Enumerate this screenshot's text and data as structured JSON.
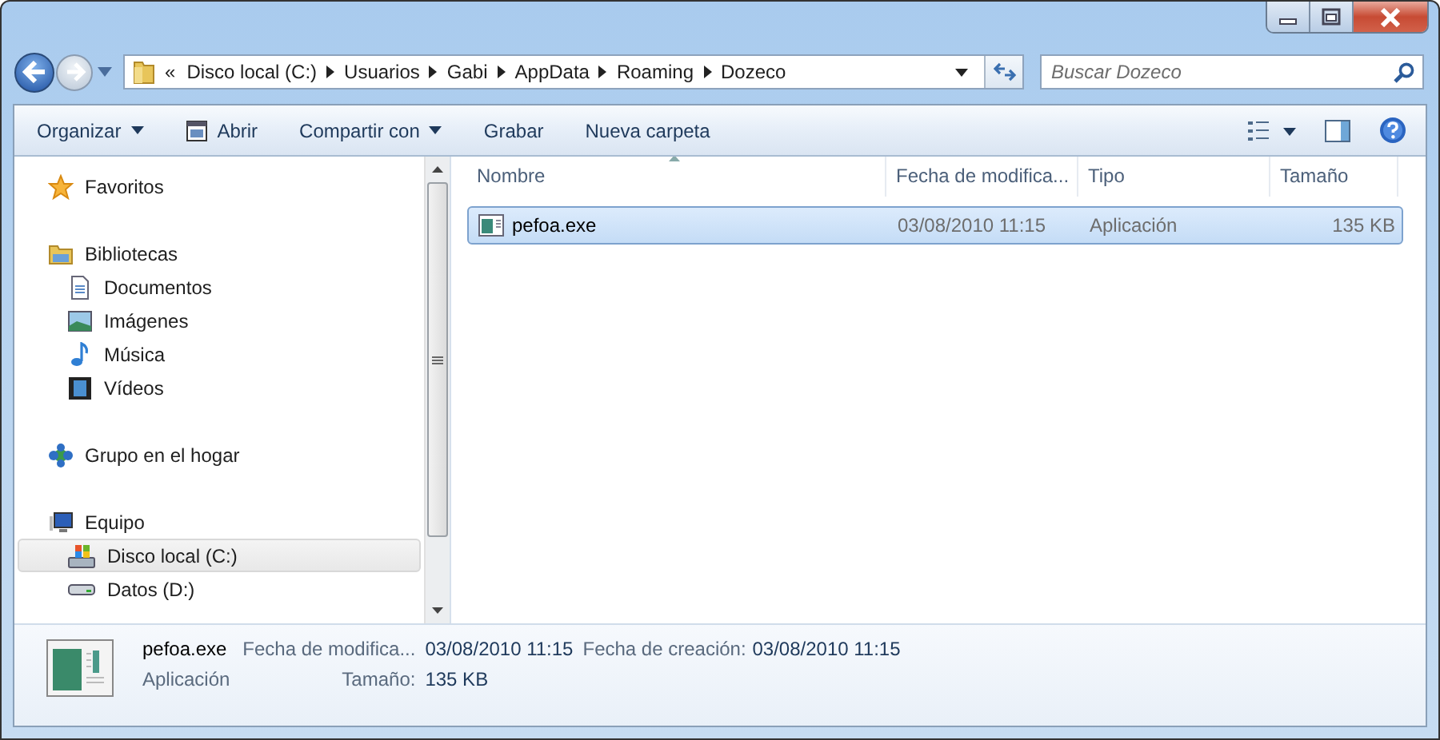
{
  "address": {
    "overflow": "«",
    "crumbs": [
      "Disco local (C:)",
      "Usuarios",
      "Gabi",
      "AppData",
      "Roaming",
      "Dozeco"
    ]
  },
  "search": {
    "placeholder": "Buscar Dozeco"
  },
  "toolbar": [
    {
      "label": "Organizar",
      "kind": "menu"
    },
    {
      "label": "Abrir",
      "kind": "open"
    },
    {
      "label": "Compartir con",
      "kind": "menu"
    },
    {
      "label": "Grabar",
      "kind": "plain"
    },
    {
      "label": "Nueva carpeta",
      "kind": "plain"
    }
  ],
  "sidebar": {
    "groups": [
      {
        "label": "Favoritos",
        "kind": "favorites",
        "selected": false
      },
      {
        "label": "Bibliotecas",
        "kind": "libraries",
        "selected": false,
        "children": [
          {
            "label": "Documentos",
            "kind": "documents",
            "selected": false
          },
          {
            "label": "Imágenes",
            "kind": "pictures",
            "selected": false
          },
          {
            "label": "Música",
            "kind": "music",
            "selected": false
          },
          {
            "label": "Vídeos",
            "kind": "videos",
            "selected": false
          }
        ]
      },
      {
        "label": "Grupo en el hogar",
        "kind": "homegroup",
        "selected": false
      },
      {
        "label": "Equipo",
        "kind": "computer",
        "selected": false,
        "children": [
          {
            "label": "Disco local (C:)",
            "kind": "system-drive",
            "selected": true
          },
          {
            "label": "Datos (D:)",
            "kind": "drive",
            "selected": false
          }
        ]
      }
    ]
  },
  "table": {
    "columns": [
      "Nombre",
      "Fecha de modifica...",
      "Tipo",
      "Tamaño"
    ],
    "rows": [
      {
        "cells": [
          "pefoa.exe",
          "03/08/2010 11:15",
          "Aplicación",
          "135 KB"
        ],
        "selected": true
      }
    ]
  },
  "details": {
    "name": "pefoa.exe",
    "type": "Aplicación",
    "fields": [
      {
        "label": "Fecha de modifica...",
        "value": "03/08/2010 11:15"
      },
      {
        "label": "Tamaño:",
        "value": "135 KB"
      },
      {
        "label": "Fecha de creación:",
        "value": "03/08/2010 11:15"
      }
    ]
  }
}
